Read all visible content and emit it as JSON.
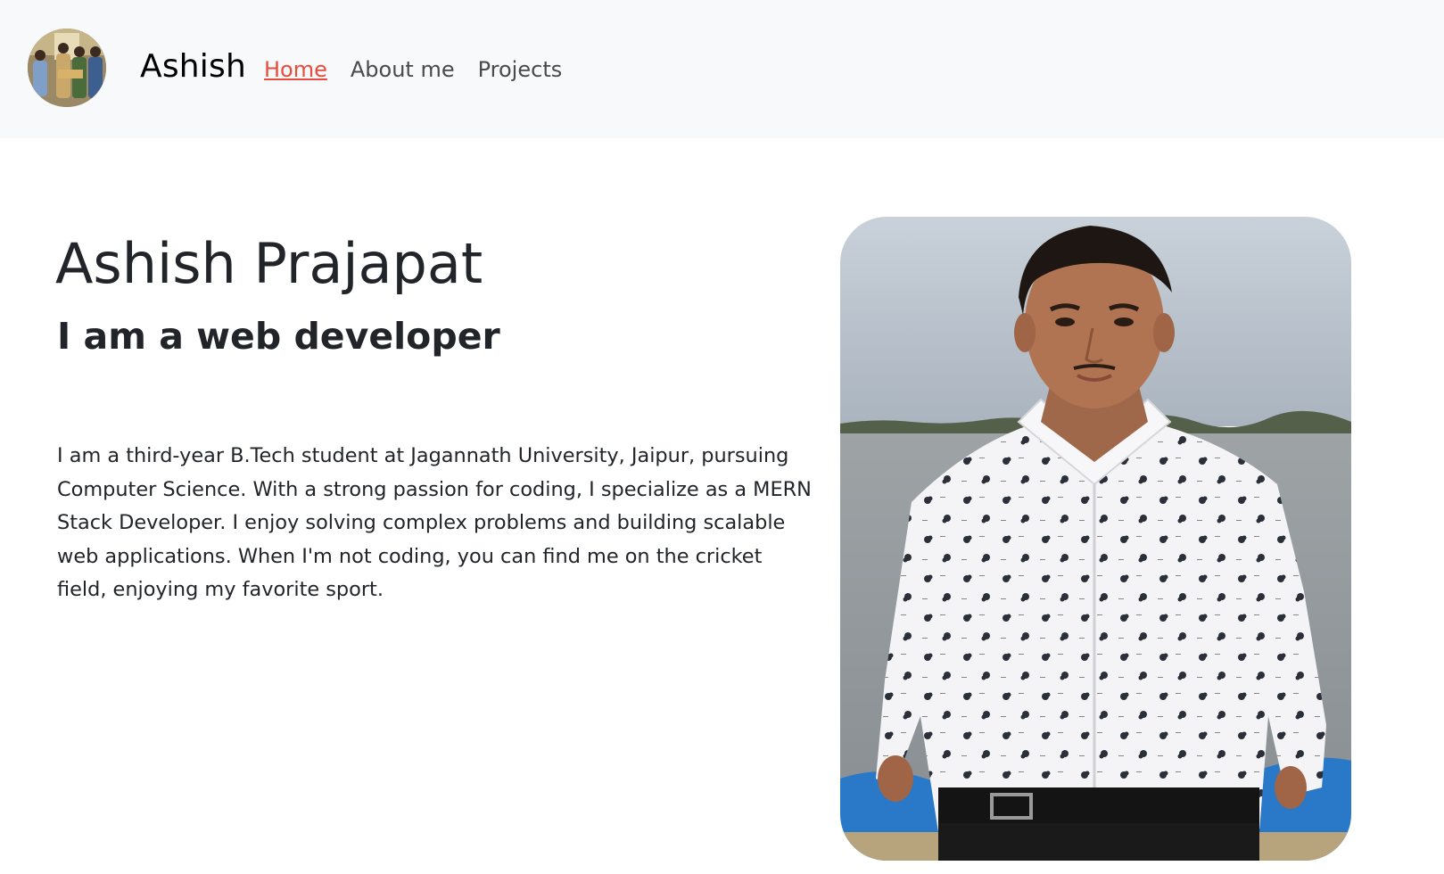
{
  "navbar": {
    "avatar_icon": "profile-photo",
    "brand": "Ashish",
    "links": [
      {
        "label": "Home",
        "active": true
      },
      {
        "label": "About me",
        "active": false
      },
      {
        "label": "Projects",
        "active": false
      }
    ]
  },
  "hero": {
    "name": "Ashish Prajapat",
    "tagline": "I am a web developer",
    "bio": "I am a third-year B.Tech student at Jagannath University, Jaipur, pursuing Computer Science. With a strong passion for coding, I specialize as a MERN Stack Developer. I enjoy solving complex problems and building scalable web applications. When I'm not coding, you can find me on the cricket field, enjoying my favorite sport."
  },
  "colors": {
    "navbar_bg": "#f8f9fa",
    "active_link": "#e74c3c",
    "text": "#212529"
  }
}
